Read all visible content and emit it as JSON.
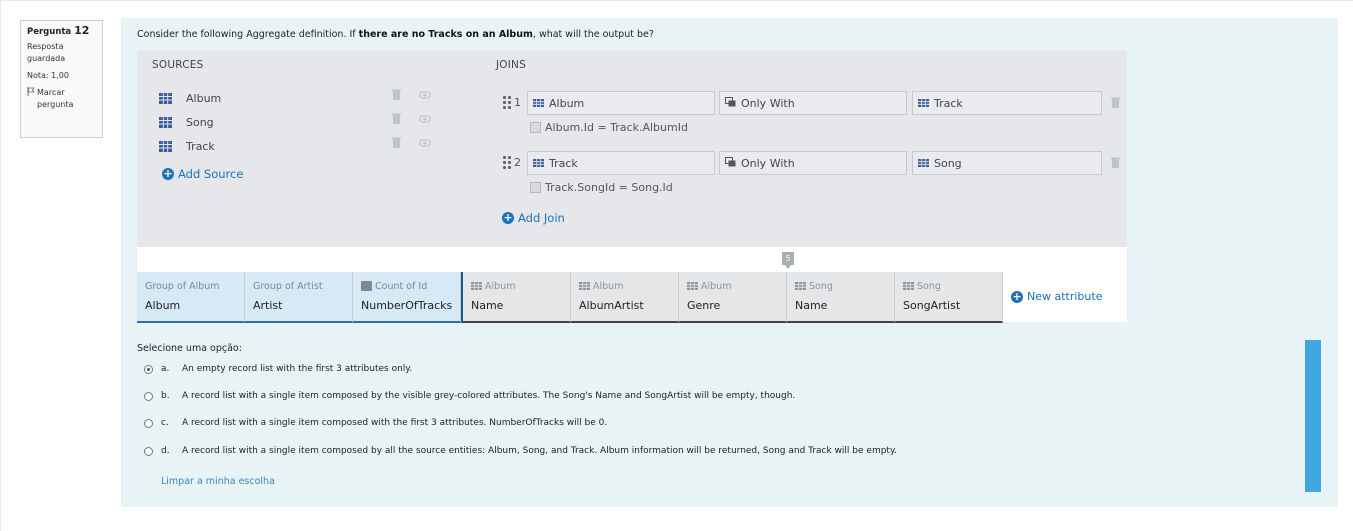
{
  "info": {
    "question_label": "Pergunta",
    "question_number": "12",
    "status_line1": "Resposta",
    "status_line2": "guardada",
    "grade": "Nota: 1,00",
    "flag_line1": "Marcar",
    "flag_line2": "pergunta",
    "flag_icon": "flag-icon"
  },
  "question": {
    "text_before": "Consider the following Aggregate definition. If ",
    "text_bold": "there are no Tracks on an Album",
    "text_after": ", what will the output be?"
  },
  "sources": {
    "title": "SOURCES",
    "items": [
      "Album",
      "Song",
      "Track"
    ],
    "add_label": "Add Source"
  },
  "joins": {
    "title": "JOINS",
    "items": [
      {
        "index": "1",
        "left": "Album",
        "type": "Only With",
        "right": "Track",
        "condition": "Album.Id = Track.AlbumId"
      },
      {
        "index": "2",
        "left": "Track",
        "type": "Only With",
        "right": "Song",
        "condition": "Track.SongId = Song.Id"
      }
    ],
    "add_label": "Add Join"
  },
  "attributes": {
    "marker": "5",
    "columns": [
      {
        "caption": "Group of Album",
        "name": "Album",
        "kind": "group"
      },
      {
        "caption": "Group of Artist",
        "name": "Artist",
        "kind": "group"
      },
      {
        "caption": "Count of Id",
        "name": "NumberOfTracks",
        "kind": "group"
      },
      {
        "caption": "Album",
        "name": "Name",
        "kind": "grey"
      },
      {
        "caption": "Album",
        "name": "AlbumArtist",
        "kind": "grey"
      },
      {
        "caption": "Album",
        "name": "Genre",
        "kind": "grey"
      },
      {
        "caption": "Song",
        "name": "Name",
        "kind": "grey"
      },
      {
        "caption": "Song",
        "name": "SongArtist",
        "kind": "grey"
      }
    ],
    "new_label": "New attribute"
  },
  "answers": {
    "prompt": "Selecione uma opção:",
    "selected": "a",
    "options": [
      {
        "letter": "a.",
        "text": "An empty record list with the first 3 attributes only."
      },
      {
        "letter": "b.",
        "text": "A record list with a single item composed by the visible grey-colored attributes. The Song's Name and SongArtist will be empty, though."
      },
      {
        "letter": "c.",
        "text": "A record list with a single item composed with the first 3 attributes. NumberOfTracks will be 0."
      },
      {
        "letter": "d.",
        "text": "A record list with a single item composed by all the source entities: Album, Song, and Track. Album information will be returned, Song and Track will be empty."
      }
    ],
    "clear_label": "Limpar a minha escolha"
  },
  "colors": {
    "panel": "#e7f3f5",
    "accent": "#1d72b8",
    "group_bg": "#d6e9f5",
    "scrollbar": "#3ea6e0"
  }
}
